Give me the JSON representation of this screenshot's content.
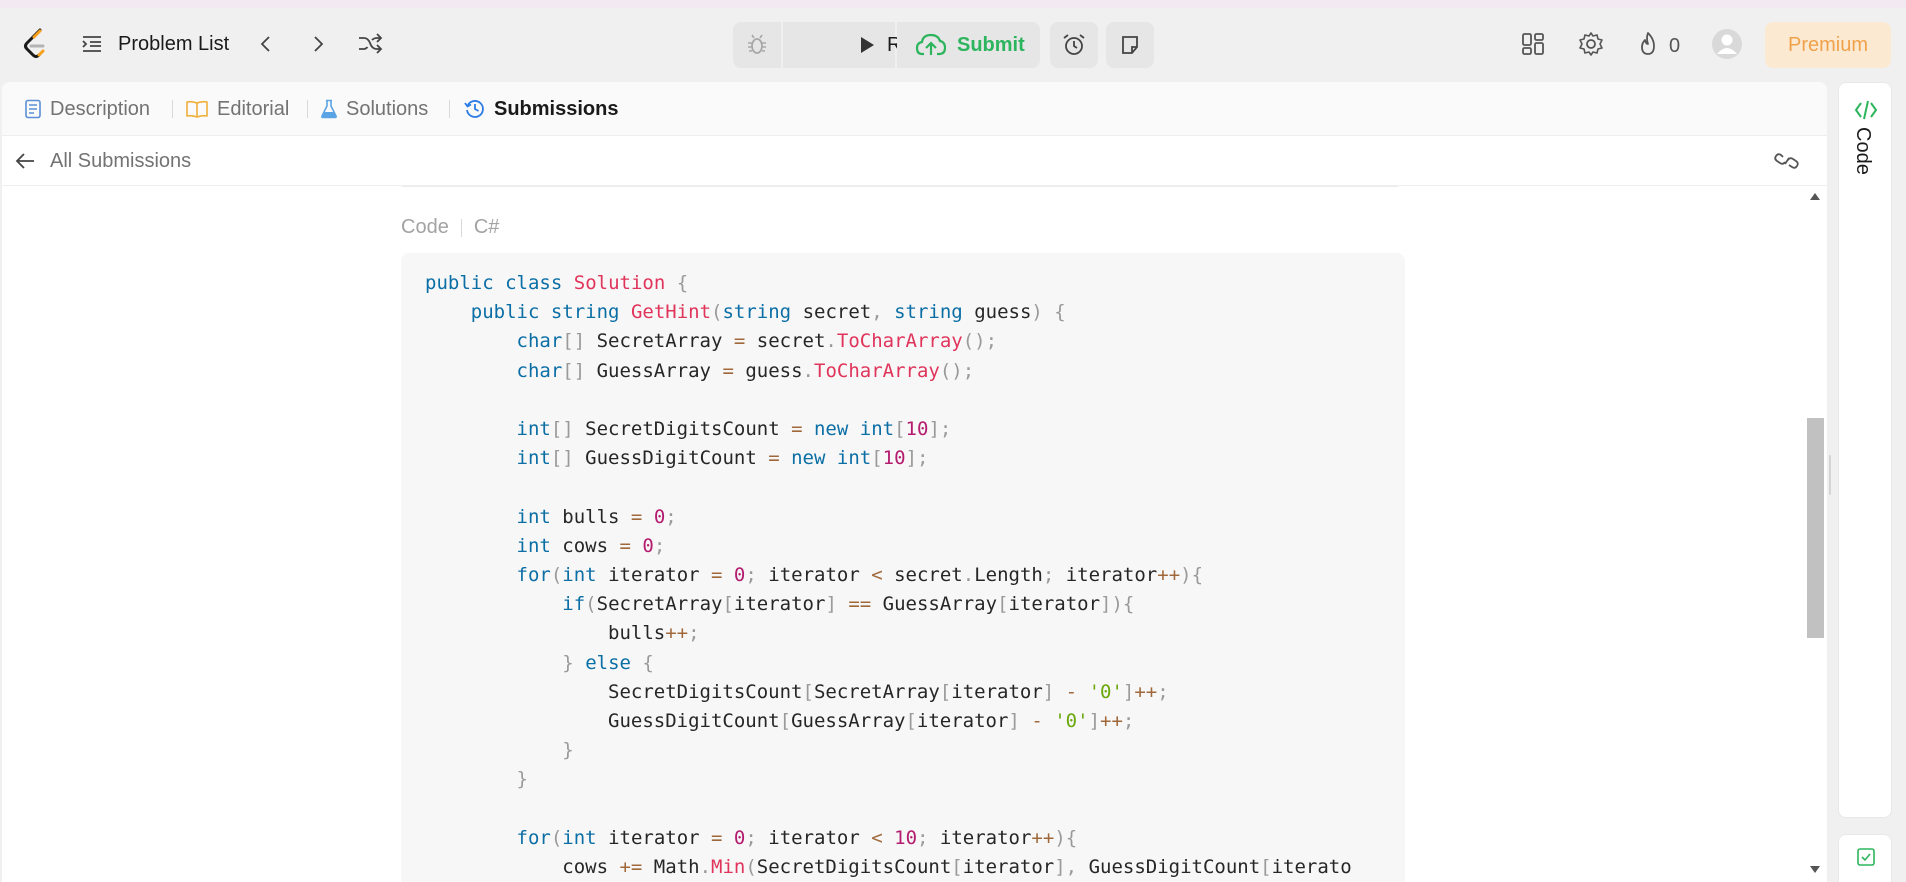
{
  "navbar": {
    "problem_list_label": "Problem List",
    "run_label": "Run",
    "submit_label": "Submit",
    "streak_count": "0",
    "premium_label": "Premium"
  },
  "tabs": [
    {
      "label": "Description",
      "icon": "description-icon",
      "active": false
    },
    {
      "label": "Editorial",
      "icon": "book-icon",
      "active": false
    },
    {
      "label": "Solutions",
      "icon": "flask-icon",
      "active": false
    },
    {
      "label": "Submissions",
      "icon": "history-icon",
      "active": true
    }
  ],
  "submission": {
    "back_label": "All Submissions",
    "code_label": "Code",
    "language": "C#",
    "code_lines": [
      "public class Solution {",
      "    public string GetHint(string secret, string guess) {",
      "        char[] SecretArray = secret.ToCharArray();",
      "        char[] GuessArray = guess.ToCharArray();",
      "",
      "        int[] SecretDigitsCount = new int[10];",
      "        int[] GuessDigitCount = new int[10];",
      "",
      "        int bulls = 0;",
      "        int cows = 0;",
      "        for(int iterator = 0; iterator < secret.Length; iterator++){",
      "            if(SecretArray[iterator] == GuessArray[iterator]){",
      "                bulls++;",
      "            } else {",
      "                SecretDigitsCount[SecretArray[iterator] - '0']++;",
      "                GuessDigitCount[GuessArray[iterator] - '0']++;",
      "            }",
      "        }",
      "",
      "        for(int iterator = 0; iterator < 10; iterator++){",
      "            cows += Math.Min(SecretDigitsCount[iterator], GuessDigitCount[iterato"
    ]
  },
  "side_panel": {
    "code_tab_label": "Code"
  },
  "colors": {
    "accent_green": "#2db55d",
    "premium_text": "#f0a24a",
    "premium_bg": "#fce9d2",
    "keyword": "#0b6fa6",
    "function": "#e0345b",
    "number": "#b41d6f",
    "string": "#6aa80c"
  }
}
